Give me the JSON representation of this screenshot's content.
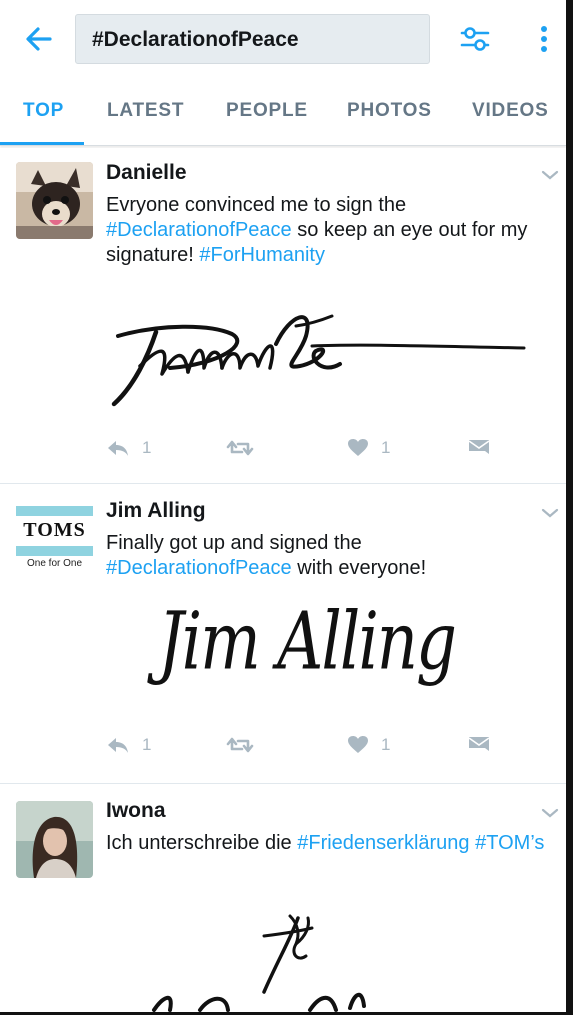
{
  "search": {
    "query": "#DeclarationofPeace"
  },
  "tabs": [
    "TOP",
    "LATEST",
    "PEOPLE",
    "PHOTOS",
    "VIDEOS"
  ],
  "icons": {
    "back": "arrow-left-icon",
    "filter": "sliders-icon",
    "more": "more-vertical-icon",
    "caret": "chevron-down-icon",
    "reply": "reply-icon",
    "retweet": "retweet-icon",
    "like": "heart-icon",
    "dm": "envelope-icon"
  },
  "colors": {
    "accent": "#1da1f2",
    "muted": "#aab8c2",
    "text": "#14171a",
    "search_bg": "#e6ecf0"
  },
  "tweets": [
    {
      "name": "Danielle",
      "text_before": "Evryone convinced me to sign the ",
      "tag1": "#DeclarationofPeace",
      "text_after": " so keep an eye out for my signature! ",
      "tag2": "#ForHumanity",
      "reply_count": "1",
      "like_count": "1"
    },
    {
      "name": "Jim Alling",
      "avatar_brand": "TOMS",
      "avatar_tagline": "One for One",
      "text_before": "Finally got up and signed the ",
      "tag1": "#DeclarationofPeace",
      "text_after": " with everyone!",
      "signature": "Jim Alling",
      "reply_count": "1",
      "like_count": "1"
    },
    {
      "name": "Iwona",
      "text_before": "Ich unterschreibe die ",
      "tag1": "#Friedenserklärung",
      "text_after": " ",
      "tag2": "#TOM’s"
    }
  ]
}
